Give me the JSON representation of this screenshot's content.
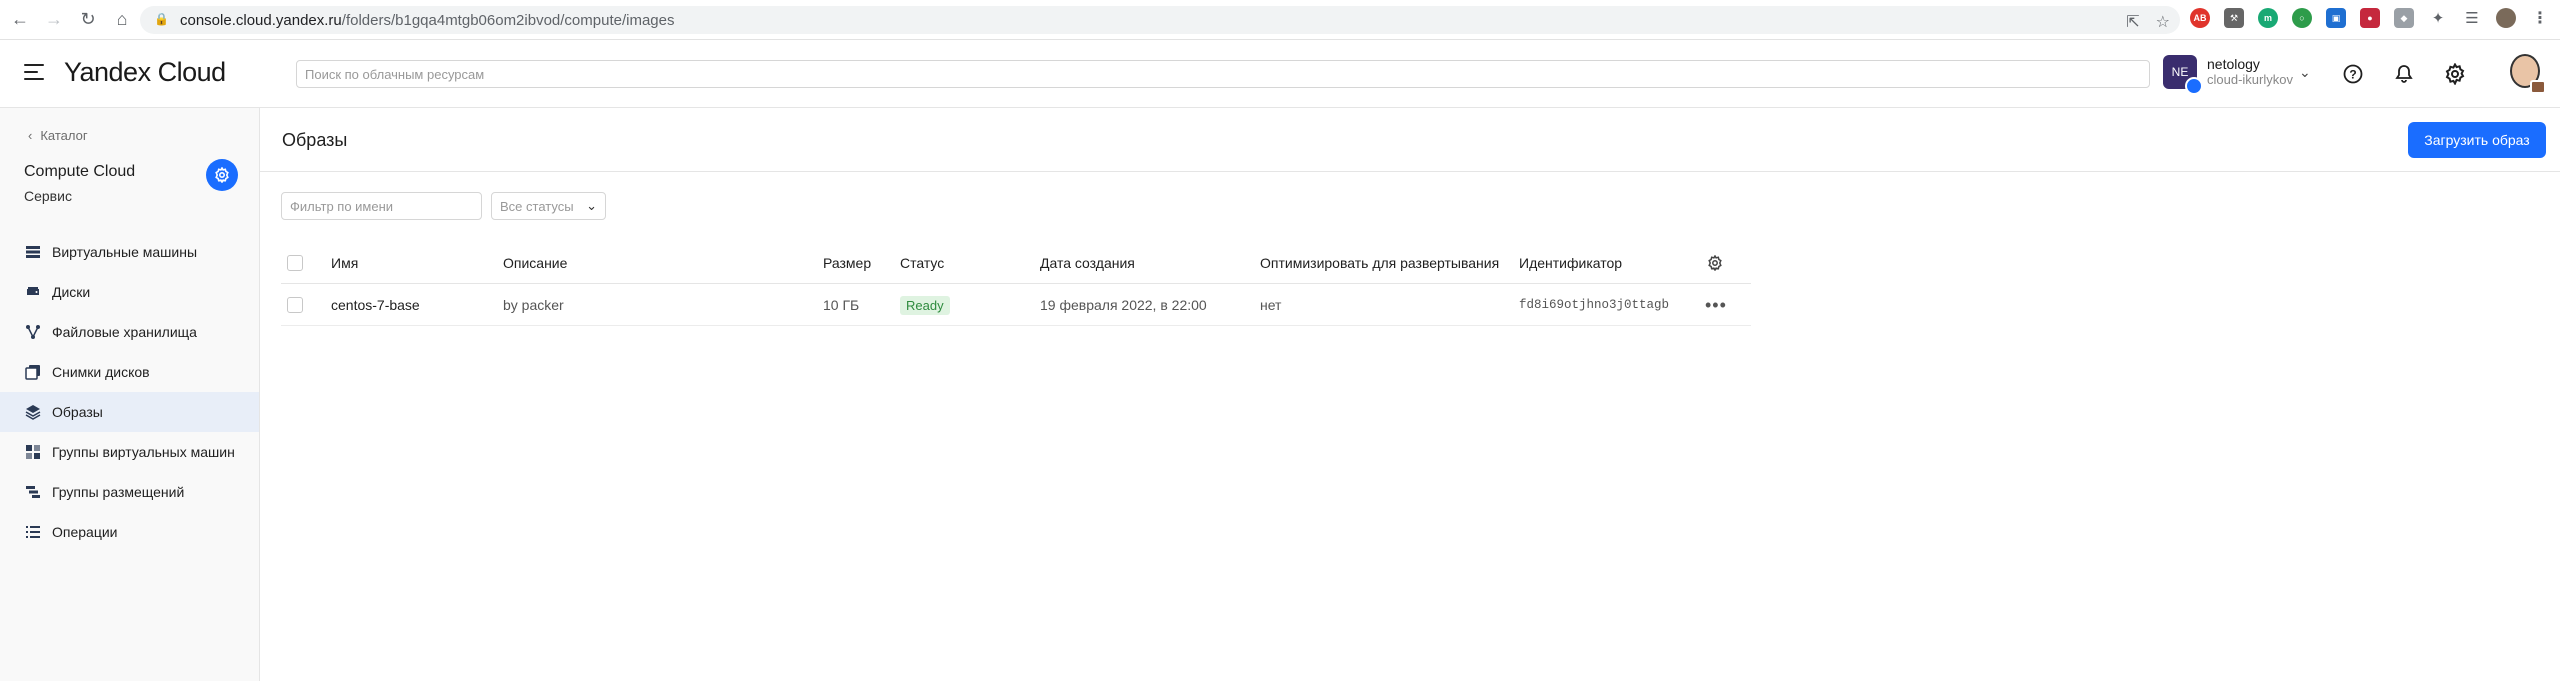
{
  "browser": {
    "url_host": "console.cloud.yandex.ru",
    "url_path": "/folders/b1gqa4mtgb06om2ibvod/compute/images"
  },
  "header": {
    "logo": "Yandex Cloud",
    "search_placeholder": "Поиск по облачным ресурсам",
    "account_initials": "NE",
    "account_name": "netology",
    "account_cloud": "cloud-ikurlykov"
  },
  "sidebar": {
    "back_label": "Каталог",
    "service_title": "Compute Cloud",
    "service_subtitle": "Сервис",
    "items": [
      {
        "label": "Виртуальные машины",
        "icon": "server-icon"
      },
      {
        "label": "Диски",
        "icon": "disk-icon"
      },
      {
        "label": "Файловые хранилища",
        "icon": "share-icon"
      },
      {
        "label": "Снимки дисков",
        "icon": "snapshot-icon"
      },
      {
        "label": "Образы",
        "icon": "layers-icon",
        "active": true
      },
      {
        "label": "Группы виртуальных машин",
        "icon": "group-icon"
      },
      {
        "label": "Группы размещений",
        "icon": "placement-icon"
      },
      {
        "label": "Операции",
        "icon": "list-icon"
      }
    ]
  },
  "main": {
    "title": "Образы",
    "upload_button": "Загрузить образ",
    "filter_placeholder": "Фильтр по имени",
    "status_filter": "Все статусы",
    "columns": [
      "Имя",
      "Описание",
      "Размер",
      "Статус",
      "Дата создания",
      "Оптимизировать для развертывания",
      "Идентификатор"
    ],
    "rows": [
      {
        "name": "centos-7-base",
        "description": "by packer",
        "size": "10 ГБ",
        "status": "Ready",
        "created": "19 февраля 2022, в 22:00",
        "optimize": "нет",
        "id": "fd8i69otjhno3j0ttagb"
      }
    ]
  },
  "colors": {
    "accent": "#1a6dff",
    "status_ready_bg": "#dff3e1",
    "status_ready_text": "#2e8b3e",
    "sidebar_active": "#e8eef8"
  }
}
